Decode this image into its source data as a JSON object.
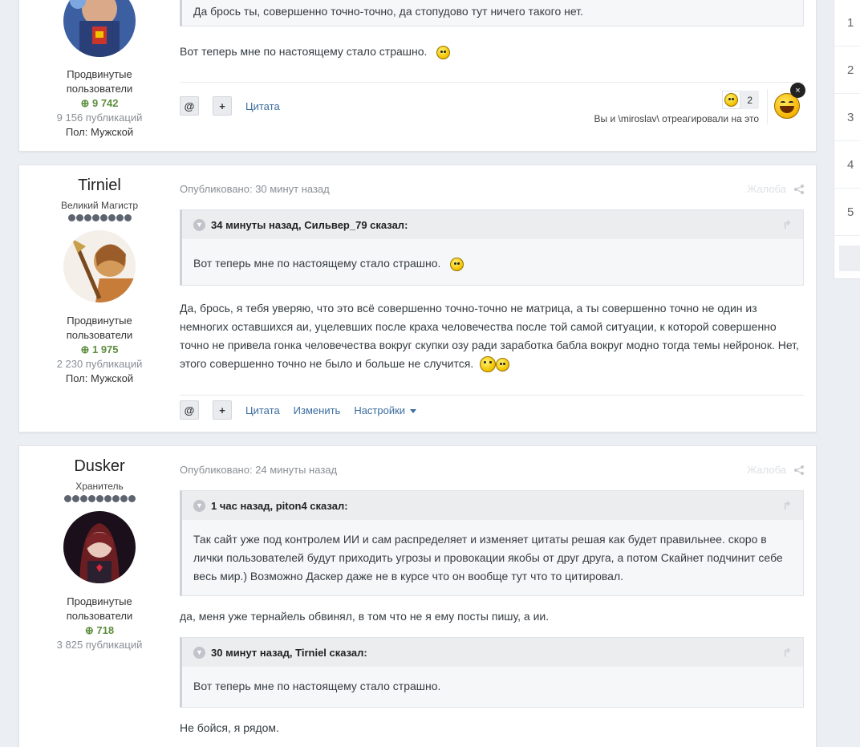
{
  "posts": [
    {
      "author": {
        "group": "Продвинутые пользователи",
        "rep": "9 742",
        "pubs": "9 156 публикаций",
        "gender": "Пол: Мужской"
      },
      "quote_top": "Да брось ты, совершенно точно-точно, да стопудово тут ничего такого нет.",
      "text": "Вот теперь мне по настоящему стало страшно.",
      "actions": {
        "mention": "@",
        "plus": "+",
        "quote": "Цитата"
      },
      "reaction": {
        "count": "2",
        "text": "Вы и \\miroslav\\ отреагировали на это",
        "close": "×"
      }
    },
    {
      "author": {
        "name": "Tirniel",
        "rank": "Великий Магистр",
        "group": "Продвинутые пользователи",
        "rep": "1 975",
        "pubs": "2 230 публикаций",
        "gender": "Пол: Мужской"
      },
      "meta": "Опубликовано: 30 минут назад",
      "meta_right": "Жалоба",
      "quote": {
        "header": "34 минуты назад, Сильвер_79 сказал:",
        "body": "Вот теперь мне по настоящему стало страшно."
      },
      "text": "Да, брось, я тебя уверяю, что это всё совершенно точно-точно не матрица, а ты совершенно точно не один из немногих оставшихся аи, уцелевших после краха человечества после той самой ситуации, к которой совершенно точно не привела гонка человечества вокруг скупки озу ради заработка бабла вокруг модно тогда темы нейронок. Нет, этого совершенно точно не было и больше не случится.",
      "actions": {
        "mention": "@",
        "plus": "+",
        "quote": "Цитата",
        "edit": "Изменить",
        "settings": "Настройки"
      }
    },
    {
      "author": {
        "name": "Dusker",
        "rank": "Хранитель",
        "group": "Продвинутые пользователи",
        "rep": "718",
        "pubs": "3 825 публикаций"
      },
      "meta": "Опубликовано: 24 минуты назад",
      "meta_right": "Жалоба",
      "quote1": {
        "header": "1 час назад, piton4 сказал:",
        "body": "Так сайт уже под контролем ИИ и сам распределяет и изменяет цитаты решая как будет правильнее. скоро в лички пользователей будут приходить угрозы и провокации якобы от друг друга, а потом Скайнет подчинит себе весь мир.) Возможно Даскер даже не в курсе что он вообще тут что то цитировал."
      },
      "text1": "да, меня уже тернайель обвинял, в том что не я ему посты пишу, а ии.",
      "quote2": {
        "header": "30 минут назад, Tirniel сказал:",
        "body": "Вот теперь мне по настоящему стало страшно."
      },
      "text2": "Не бойся, я рядом."
    }
  ],
  "pager": [
    "1",
    "2",
    "3",
    "4",
    "5"
  ],
  "colors": {
    "rep": "#5d8e3d",
    "link": "#3a6c9f",
    "background": "#ebeef2"
  }
}
